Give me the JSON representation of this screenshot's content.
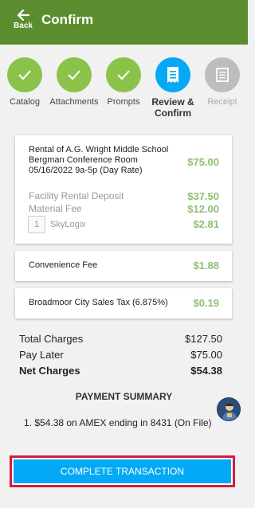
{
  "header": {
    "back_label": "Back",
    "title": "Confirm",
    "bg_color": "#5b8d2e"
  },
  "steps": [
    {
      "label": "Catalog",
      "state": "done",
      "icon": "check-icon"
    },
    {
      "label": "Attachments",
      "state": "done",
      "icon": "check-icon"
    },
    {
      "label": "Prompts",
      "state": "done",
      "icon": "check-icon"
    },
    {
      "label": "Review &",
      "label2": "Confirm",
      "state": "active",
      "icon": "receipt-icon"
    },
    {
      "label": "Receipt",
      "state": "pending",
      "icon": "receipt-icon"
    }
  ],
  "rental": {
    "desc_line1": "Rental of A.G. Wright Middle School",
    "desc_line2": "Bergman Conference Room",
    "desc_line3": "05/16/2022 9a-5p (Day Rate)",
    "price": "$75.00",
    "deposit_label": "Facility Rental Deposit",
    "deposit_price": "$37.50",
    "material_label": "Material Fee",
    "material_price": "$12.00",
    "qty": "1",
    "vendor_label": "SkyLogix",
    "vendor_price": "$2.81"
  },
  "convenience": {
    "label": "Convenience Fee",
    "price": "$1.88"
  },
  "tax": {
    "label": "Broadmoor City Sales Tax (6.875%)",
    "price": "$0.19"
  },
  "totals": {
    "total_label": "Total Charges",
    "total_value": "$127.50",
    "later_label": "Pay Later",
    "later_value": "$75.00",
    "net_label": "Net Charges",
    "net_value": "$54.38"
  },
  "payment": {
    "title": "PAYMENT SUMMARY",
    "line": "1. $54.38 on AMEX ending in 8431 (On File)"
  },
  "complete_label": "COMPLETE TRANSACTION",
  "colors": {
    "accent": "#03a9f4",
    "done": "#8bc34a",
    "price": "#8fbf72",
    "highlight": "#d81b3c"
  }
}
